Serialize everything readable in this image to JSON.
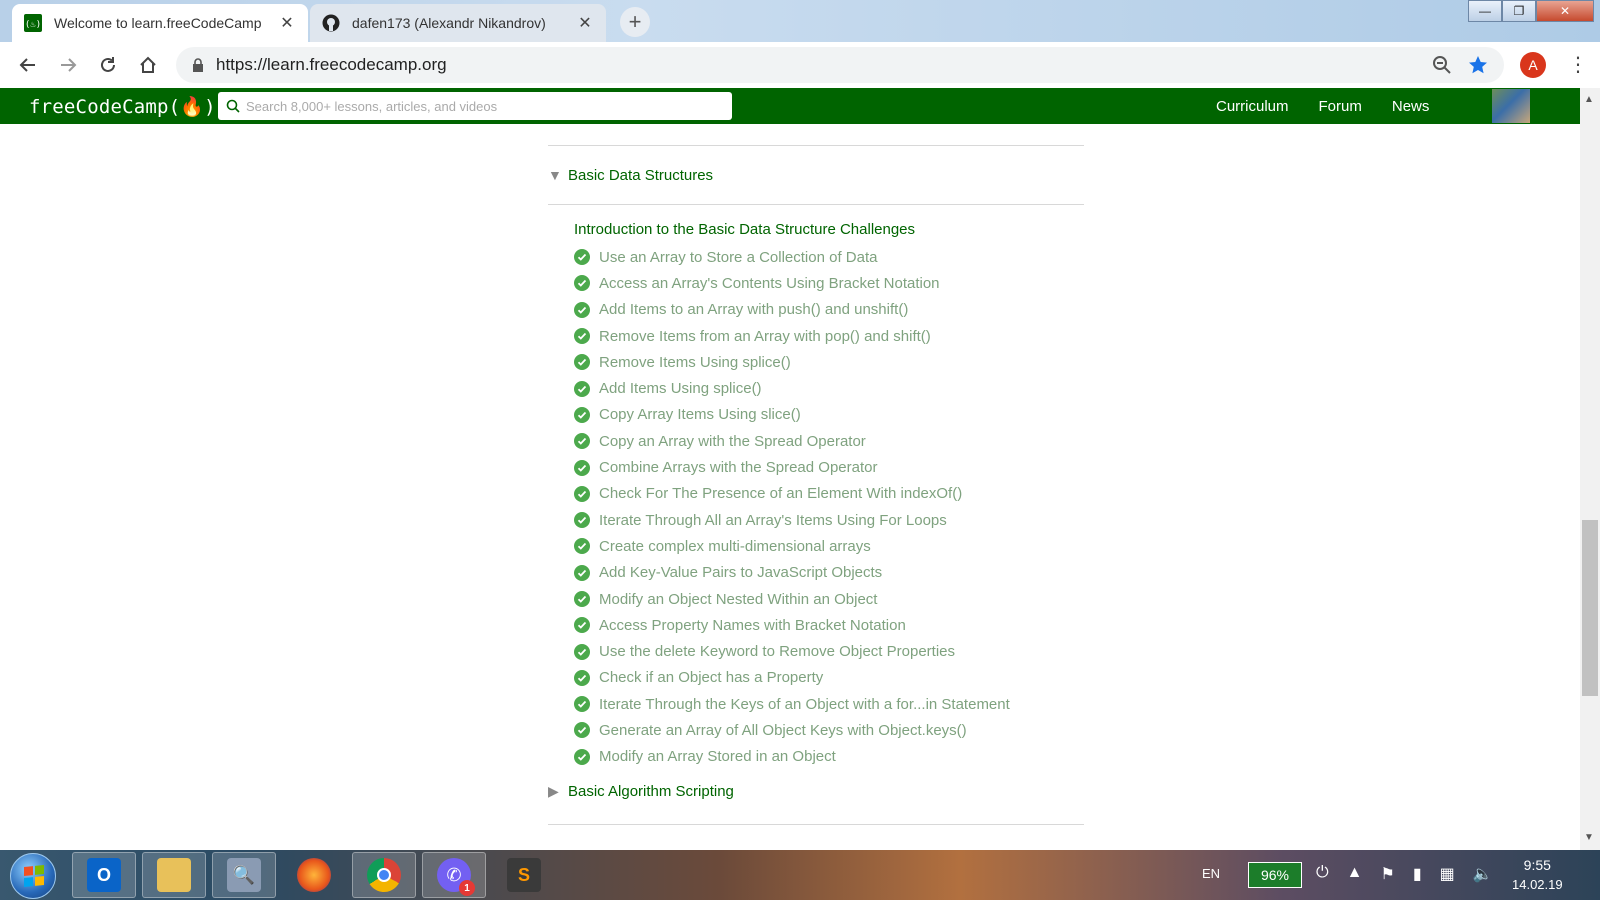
{
  "browser": {
    "tabs": [
      {
        "label": "Welcome to learn.freeCodeCamp",
        "active": true,
        "favicon": "freecodecamp-icon"
      },
      {
        "label": "dafen173 (Alexandr Nikandrov)",
        "active": false,
        "favicon": "github-icon"
      }
    ],
    "new_tab": "+",
    "url": "https://learn.freecodecamp.org",
    "profile_initial": "A"
  },
  "fcc_nav": {
    "logo": "freeCodeCamp(🔥)",
    "search_placeholder": "Search 8,000+ lessons, articles, and videos",
    "links": [
      "Curriculum",
      "Forum",
      "News"
    ]
  },
  "curriculum": {
    "block_expanded": "Basic Data Structures",
    "intro": "Introduction to the Basic Data Structure Challenges",
    "challenges": [
      "Use an Array to Store a Collection of Data",
      "Access an Array's Contents Using Bracket Notation",
      "Add Items to an Array with push() and unshift()",
      "Remove Items from an Array with pop() and shift()",
      "Remove Items Using splice()",
      "Add Items Using splice()",
      "Copy Array Items Using slice()",
      "Copy an Array with the Spread Operator",
      "Combine Arrays with the Spread Operator",
      "Check For The Presence of an Element With indexOf()",
      "Iterate Through All an Array's Items Using For Loops",
      "Create complex multi-dimensional arrays",
      "Add Key-Value Pairs to JavaScript Objects",
      "Modify an Object Nested Within an Object",
      "Access Property Names with Bracket Notation",
      "Use the delete Keyword to Remove Object Properties",
      "Check if an Object has a Property",
      " Iterate Through the Keys of an Object with a for...in Statement",
      "Generate an Array of All Object Keys with Object.keys()",
      "Modify an Array Stored in an Object"
    ],
    "block_collapsed": "Basic Algorithm Scripting"
  },
  "taskbar": {
    "apps": [
      "outlook-icon",
      "file-explorer-icon",
      "network-tool-icon",
      "firefox-icon",
      "chrome-icon",
      "viber-icon",
      "sublime-text-icon"
    ],
    "viber_badge": "1",
    "language": "EN",
    "battery": "96%",
    "time": "9:55",
    "date": "14.02.19"
  },
  "colors": {
    "fcc_green": "#006400",
    "challenge_text": "#7fa27f",
    "check": "#4ca94c"
  }
}
